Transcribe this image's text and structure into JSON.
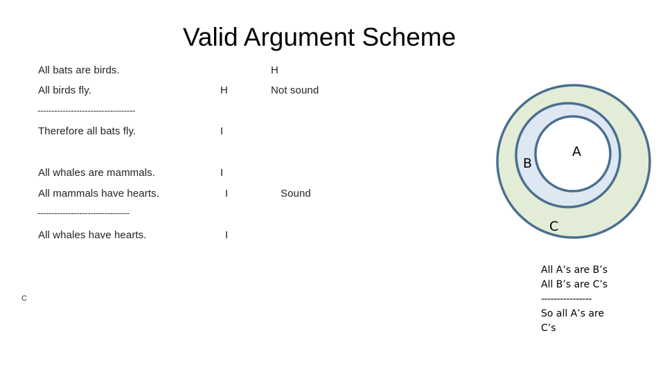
{
  "slide": {
    "title": "Valid Argument Scheme"
  },
  "argument1": {
    "premise1": "All bats are birds.",
    "premise2": "All birds fly.",
    "separator": "-----------------------------------",
    "conclusion": "Therefore all bats fly.",
    "premise1_truth": "H",
    "premise2_truth": "H",
    "conclusion_truth": "I",
    "verdict": "Not sound"
  },
  "argument2": {
    "premise1": "All whales are mammals.",
    "premise2": "All mammals have hearts.",
    "separator": "---------------------------------",
    "conclusion": "All whales have hearts.",
    "premise1_truth": "I",
    "premise2_truth": "I",
    "conclusion_truth": "I",
    "verdict": "Sound"
  },
  "stray_mark": "C",
  "venn": {
    "labels": {
      "A": "A",
      "B": "B",
      "C": "C"
    },
    "colors": {
      "stroke": "#4a6f8f",
      "outer_fill": "#e2ecd6",
      "middle_fill": "#dde8f3",
      "inner_fill": "#ffffff"
    }
  },
  "syllogism": {
    "line1": "All A’s are B’s",
    "line2": "All B’s are C’s",
    "separator": "----------------",
    "line3": "So all A’s are",
    "line4": "C’s"
  }
}
